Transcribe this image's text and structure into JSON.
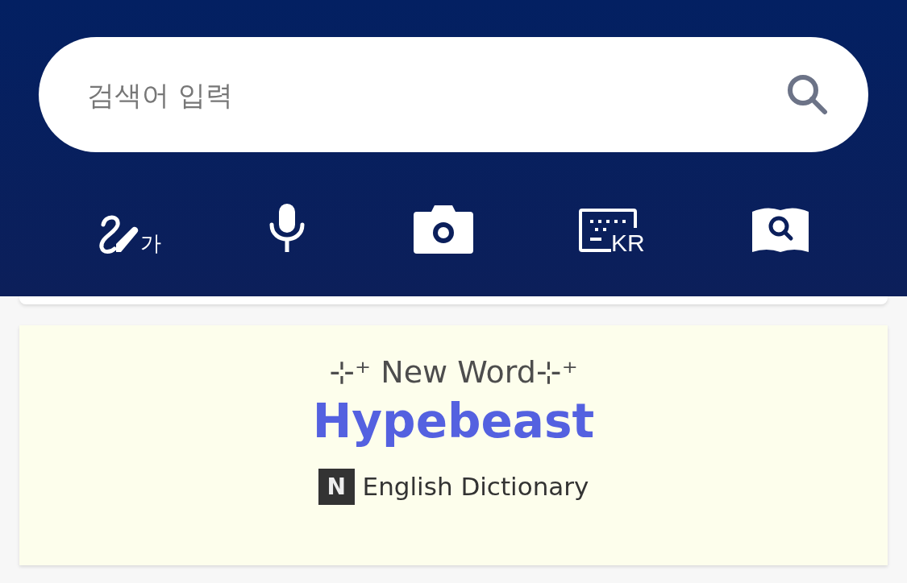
{
  "search": {
    "placeholder": "검색어 입력"
  },
  "input_tools": [
    {
      "kind": "handwriting",
      "label": "가"
    },
    {
      "kind": "voice"
    },
    {
      "kind": "camera"
    },
    {
      "kind": "keyboard",
      "label": "KR"
    },
    {
      "kind": "dictionary"
    }
  ],
  "new_word_card": {
    "heading": "⊹⁺ New Word⊹⁺",
    "word": "Hypebeast",
    "source_logo": "N",
    "source": "English Dictionary"
  }
}
